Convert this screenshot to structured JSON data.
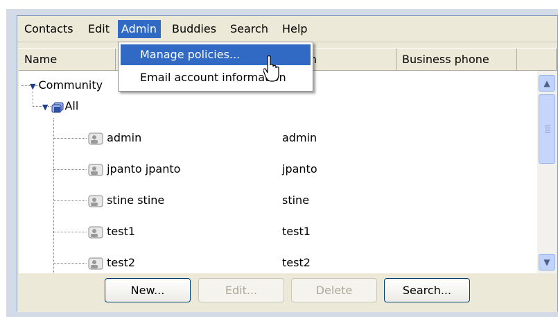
{
  "menubar": {
    "items": [
      "Contacts",
      "Edit",
      "Admin",
      "Buddies",
      "Search",
      "Help"
    ],
    "active": "Admin"
  },
  "columns": [
    "Name",
    "en",
    "Business phone",
    ""
  ],
  "tree": {
    "root": "Community",
    "group": "All",
    "contacts": [
      {
        "name": "admin",
        "screen": "admin"
      },
      {
        "name": "jpanto jpanto",
        "screen": "jpanto"
      },
      {
        "name": "stine stine",
        "screen": "stine"
      },
      {
        "name": "test1",
        "screen": "test1"
      },
      {
        "name": "test2",
        "screen": "test2"
      }
    ]
  },
  "dropdown": {
    "items": [
      "Manage policies...",
      "Email account information"
    ],
    "highlighted": "Manage policies..."
  },
  "buttons": {
    "new": "New...",
    "edit": "Edit...",
    "delete": "Delete",
    "search": "Search..."
  },
  "colors": {
    "menu_highlight": "#316ac5",
    "window_face": "#ece9d8"
  }
}
